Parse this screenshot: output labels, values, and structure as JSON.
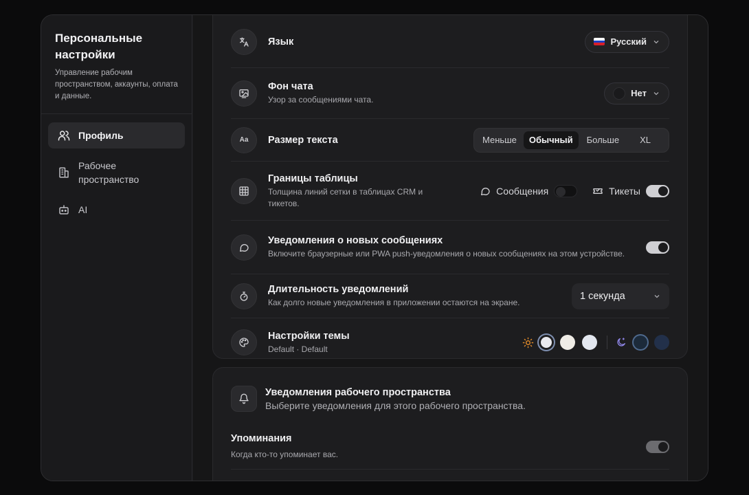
{
  "sidebar": {
    "title": "Персональные настройки",
    "description": "Управление рабочим пространством, аккаунты, оплата и данные.",
    "items": [
      {
        "label": "Профиль",
        "icon": "users-icon",
        "active": true
      },
      {
        "label": "Рабочее пространство",
        "icon": "building-icon",
        "active": false
      },
      {
        "label": "AI",
        "icon": "bot-icon",
        "active": false
      }
    ]
  },
  "settings": {
    "language": {
      "title": "Язык",
      "value": "Русский",
      "icon": "translate-icon"
    },
    "chat_background": {
      "title": "Фон чата",
      "subtitle": "Узор за сообщениями чата.",
      "value": "Нет",
      "icon": "image-icon"
    },
    "text_size": {
      "title": "Размер текста",
      "options": [
        "Меньше",
        "Обычный",
        "Больше",
        "XL"
      ],
      "selected": "Обычный",
      "icon": "font-size-icon"
    },
    "table_borders": {
      "title": "Границы таблицы",
      "subtitle": "Толщина линий сетки в таблицах CRM и тикетов.",
      "messages_label": "Сообщения",
      "messages_on": false,
      "tickets_label": "Тикеты",
      "tickets_on": true,
      "icon": "table-icon"
    },
    "new_message_notifications": {
      "title": "Уведомления о новых сообщениях",
      "subtitle": "Включите браузерные или PWA push-уведомления о новых сообщениях на этом устройстве.",
      "enabled": true,
      "icon": "chat-bubble-icon"
    },
    "notification_duration": {
      "title": "Длительность уведомлений",
      "subtitle": "Как долго новые уведомления в приложении остаются на экране.",
      "value": "1 секунда",
      "icon": "stopwatch-icon"
    },
    "theme": {
      "title": "Настройки темы",
      "subtitle": "Default · Default",
      "icon": "palette-icon",
      "light_swatches": [
        "#e9e9ee",
        "#efece6",
        "#e3e7ef"
      ],
      "dark_swatches": [
        "#1c2a3a",
        "#22304a"
      ]
    }
  },
  "workspace_notifications": {
    "title": "Уведомления рабочего пространства",
    "subtitle": "Выберите уведомления для этого рабочего пространства.",
    "icon": "bell-icon",
    "mentions": {
      "title": "Упоминания",
      "subtitle": "Когда кто-то упоминает вас.",
      "enabled": true
    }
  },
  "colors": {
    "background": "#0b0b0c",
    "panel": "#1d1d1f",
    "accent_sun": "#e08a2a",
    "accent_moon": "#8f86e8"
  }
}
